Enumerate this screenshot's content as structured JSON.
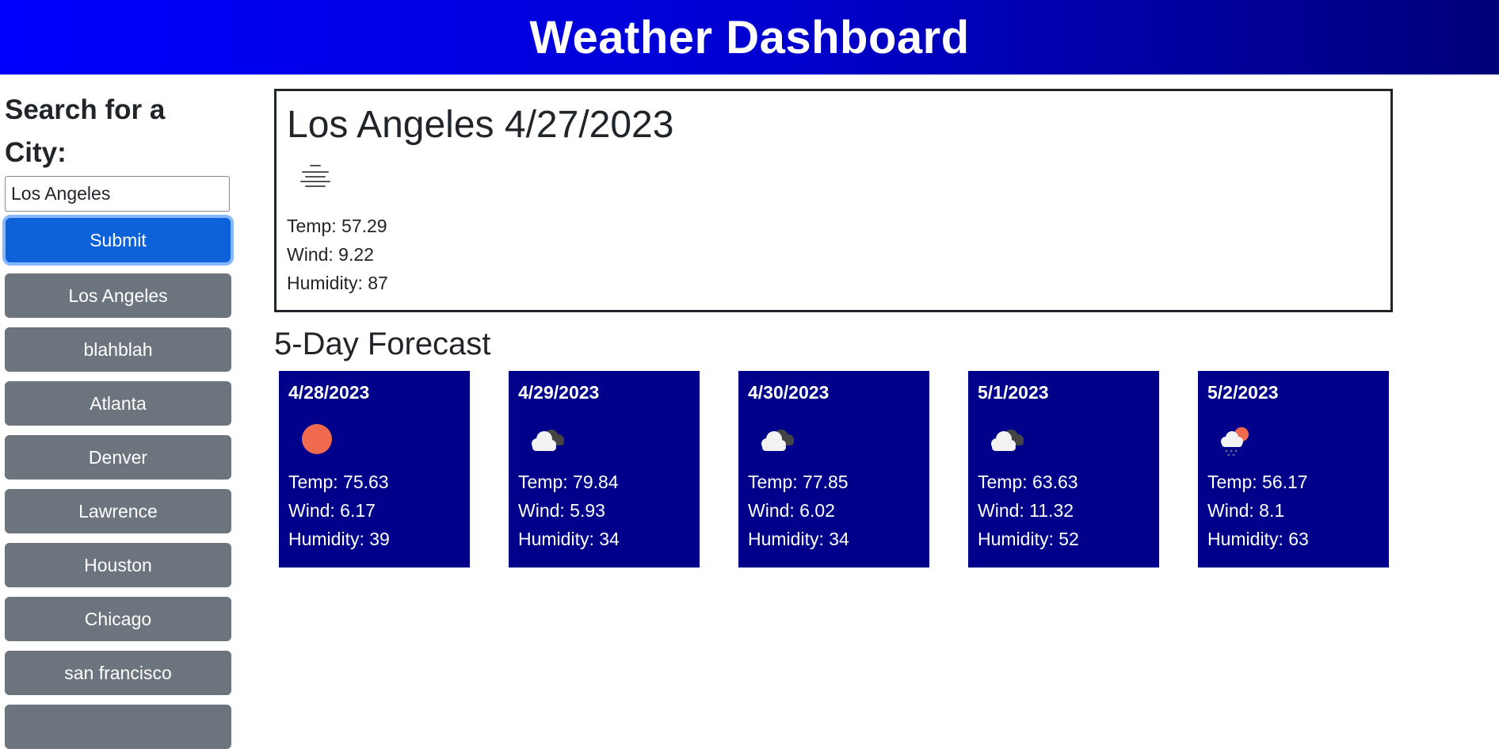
{
  "header": {
    "title": "Weather Dashboard"
  },
  "sidebar": {
    "search_label": "Search for a City:",
    "input_value": "Los Angeles",
    "submit_label": "Submit",
    "history": [
      "Los Angeles",
      "blahblah",
      "Atlanta",
      "Denver",
      "Lawrence",
      "Houston",
      "Chicago",
      "san francisco"
    ]
  },
  "current": {
    "title": "Los Angeles 4/27/2023",
    "icon": "mist-icon",
    "temp": "Temp: 57.29",
    "wind": "Wind: 9.22",
    "humidity": "Humidity: 87"
  },
  "forecast": {
    "title": "5-Day Forecast",
    "days": [
      {
        "date": "4/28/2023",
        "icon": "sun-icon",
        "temp": "Temp: 75.63",
        "wind": "Wind: 6.17",
        "humidity": "Humidity: 39"
      },
      {
        "date": "4/29/2023",
        "icon": "broken-clouds-icon",
        "temp": "Temp: 79.84",
        "wind": "Wind: 5.93",
        "humidity": "Humidity: 34"
      },
      {
        "date": "4/30/2023",
        "icon": "broken-clouds-icon",
        "temp": "Temp: 77.85",
        "wind": "Wind: 6.02",
        "humidity": "Humidity: 34"
      },
      {
        "date": "5/1/2023",
        "icon": "broken-clouds-icon",
        "temp": "Temp: 63.63",
        "wind": "Wind: 11.32",
        "humidity": "Humidity: 52"
      },
      {
        "date": "5/2/2023",
        "icon": "rain-sun-icon",
        "temp": "Temp: 56.17",
        "wind": "Wind: 8.1",
        "humidity": "Humidity: 63"
      }
    ]
  },
  "colors": {
    "header_start": "#0000ff",
    "header_end": "#00007a",
    "card_bg": "#00008b",
    "submit_bg": "#0d62d9",
    "history_bg": "#6c757d",
    "sun": "#ef6a4f"
  }
}
